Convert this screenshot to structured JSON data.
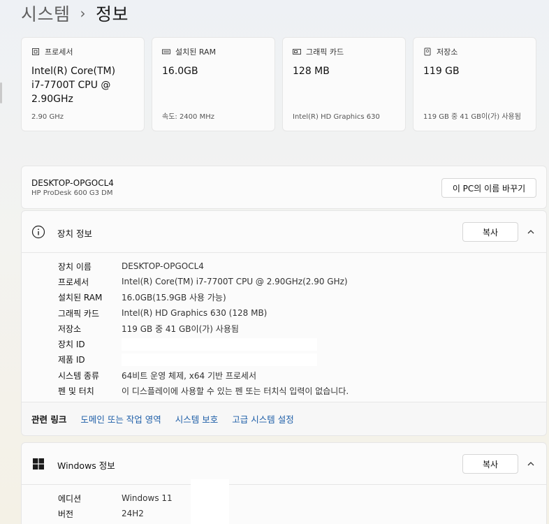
{
  "breadcrumb": {
    "parent": "시스템",
    "separator": "›",
    "current": "정보"
  },
  "cards": [
    {
      "label": "프로세서",
      "icon": "processor-icon",
      "value": "Intel(R) Core(TM) i7-7700T CPU @ 2.90GHz",
      "sub": "2.90 GHz"
    },
    {
      "label": "설치된 RAM",
      "icon": "ram-icon",
      "value": "16.0GB",
      "sub": "속도: 2400 MHz"
    },
    {
      "label": "그래픽 카드",
      "icon": "graphics-card-icon",
      "value": "128 MB",
      "sub": "Intel(R) HD Graphics 630"
    },
    {
      "label": "저장소",
      "icon": "storage-icon",
      "value": "119 GB",
      "sub": "119 GB 중 41 GB이(가) 사용됨"
    }
  ],
  "pc": {
    "name": "DESKTOP-OPGOCL4",
    "model": "HP ProDesk 600 G3 DM",
    "rename_label": "이 PC의 이름 바꾸기"
  },
  "device": {
    "title": "장치 정보",
    "copy_label": "복사",
    "specs": [
      {
        "label": "장치 이름",
        "value": "DESKTOP-OPGOCL4"
      },
      {
        "label": "프로세서",
        "value": "Intel(R) Core(TM) i7-7700T CPU @ 2.90GHz(2.90 GHz)"
      },
      {
        "label": "설치된 RAM",
        "value": "16.0GB(15.9GB 사용 가능)"
      },
      {
        "label": "그래픽 카드",
        "value": "Intel(R) HD Graphics 630 (128 MB)"
      },
      {
        "label": "저장소",
        "value": "119 GB 중 41 GB이(가) 사용됨"
      },
      {
        "label": "장치 ID",
        "value": ""
      },
      {
        "label": "제품 ID",
        "value": ""
      },
      {
        "label": "시스템 종류",
        "value": "64비트 운영 체제, x64 기반 프로세서"
      },
      {
        "label": "펜 및 터치",
        "value": "이 디스플레이에 사용할 수 있는 펜 또는 터치식 입력이 없습니다."
      }
    ],
    "related_label": "관련 링크",
    "related_links": [
      "도메인 또는 작업 영역",
      "시스템 보호",
      "고급 시스템 설정"
    ]
  },
  "windows": {
    "title": "Windows 정보",
    "copy_label": "복사",
    "specs": [
      {
        "label": "에디션",
        "value": "Windows 11"
      },
      {
        "label": "버전",
        "value": "24H2"
      }
    ]
  },
  "colors": {
    "link": "#1f5fa8",
    "card_bg": "#fbfbfb",
    "border": "#e6e6e6"
  }
}
